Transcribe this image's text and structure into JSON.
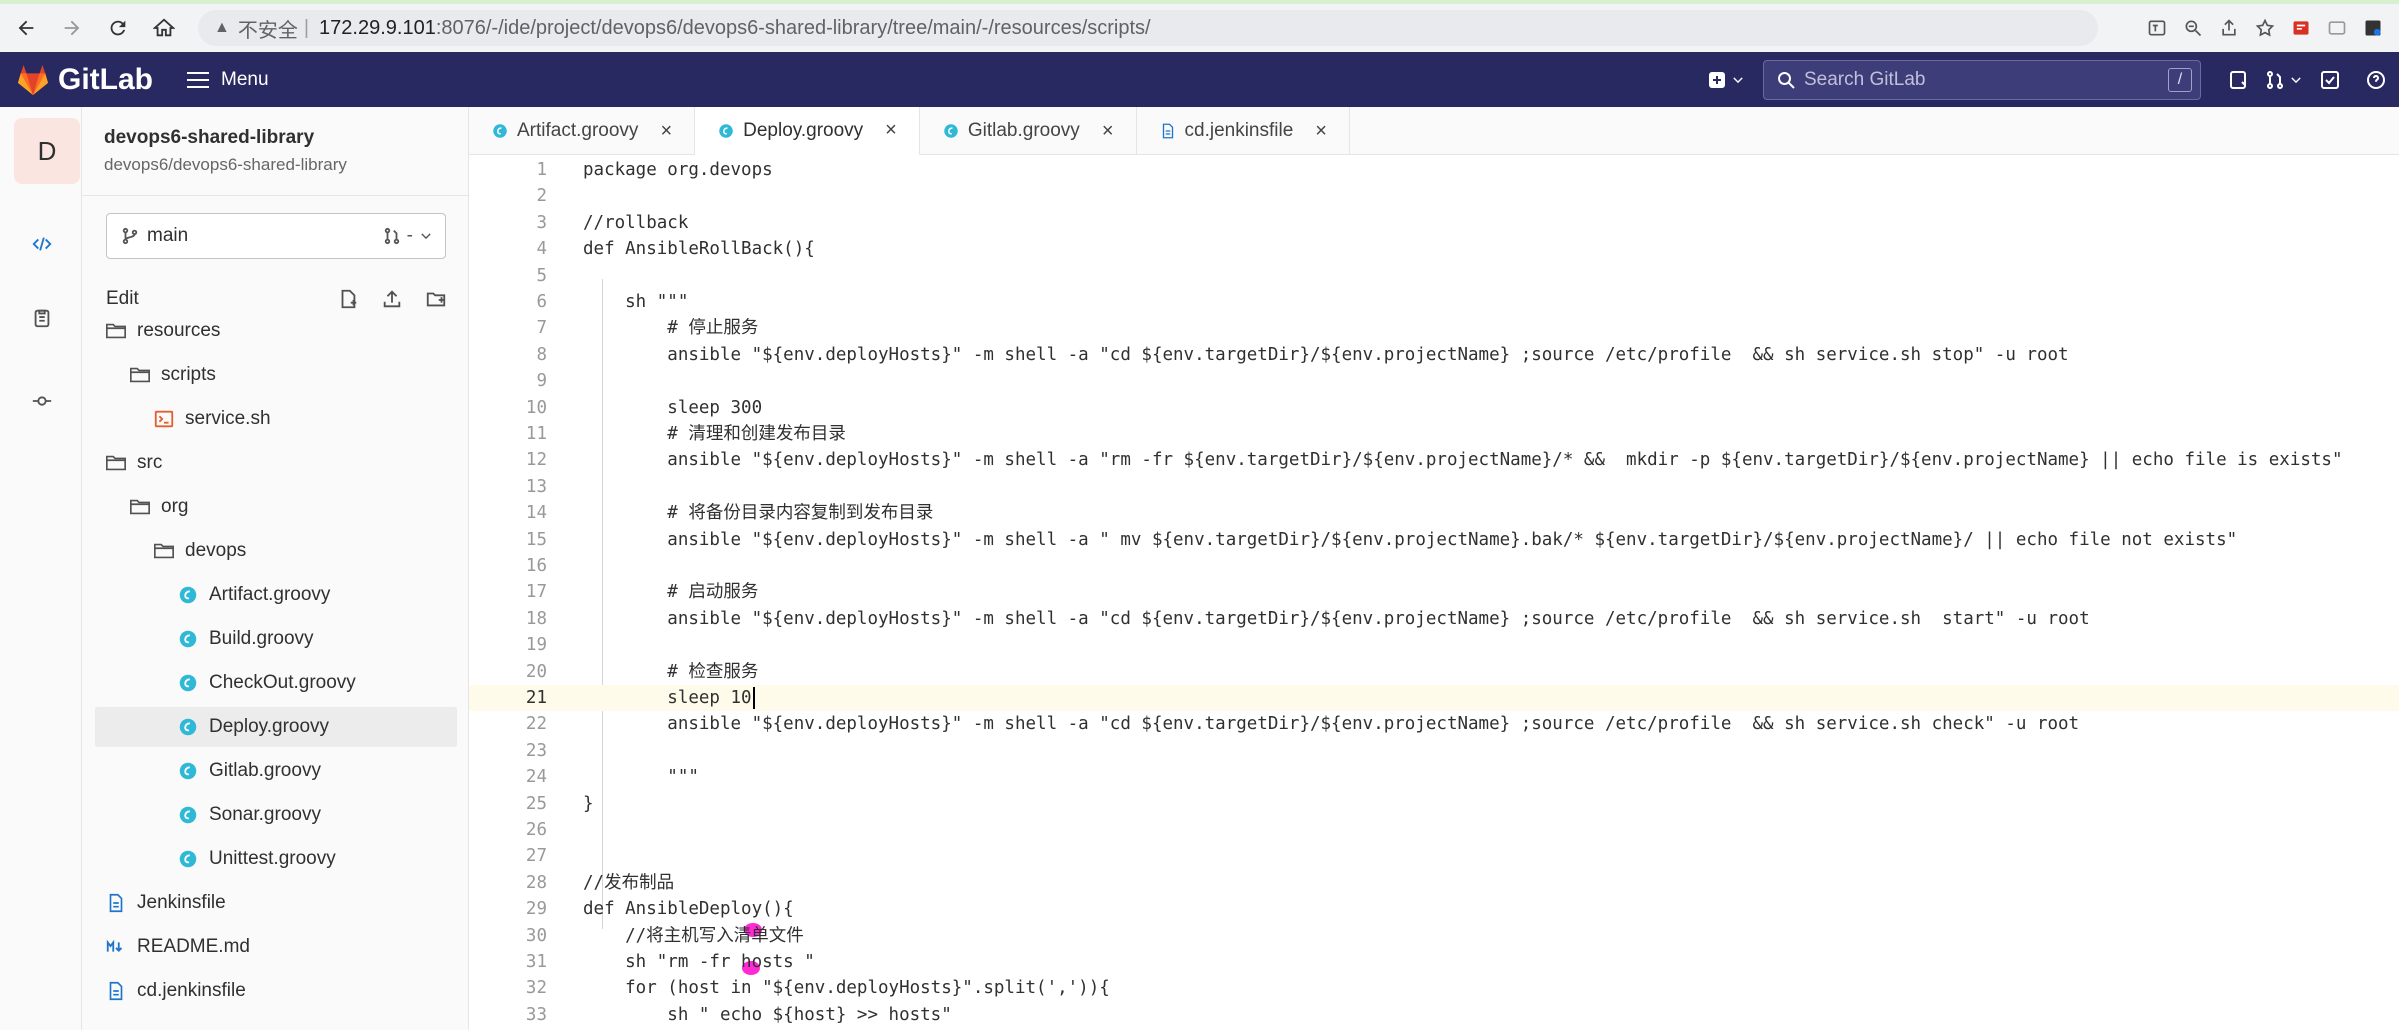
{
  "browser": {
    "insecure_label": "不安全",
    "url_host": "172.29.9.101",
    "url_path": ":8076/-/ide/project/devops6/devops6-shared-library/tree/main/-/resources/scripts/"
  },
  "header": {
    "logo_text": "GitLab",
    "menu_label": "Menu",
    "search_placeholder": "Search GitLab",
    "search_shortcut": "/"
  },
  "rail": {
    "avatar_letter": "D"
  },
  "project": {
    "name": "devops6-shared-library",
    "path": "devops6/devops6-shared-library",
    "branch": "main",
    "branch_suffix": "-",
    "edit_label": "Edit"
  },
  "tree": [
    {
      "label": "resources",
      "type": "folder",
      "depth": 0
    },
    {
      "label": "scripts",
      "type": "folder",
      "depth": 1
    },
    {
      "label": "service.sh",
      "type": "shell",
      "depth": 2
    },
    {
      "label": "src",
      "type": "folder",
      "depth": 0
    },
    {
      "label": "org",
      "type": "folder",
      "depth": 1
    },
    {
      "label": "devops",
      "type": "folder",
      "depth": 2
    },
    {
      "label": "Artifact.groovy",
      "type": "groovy",
      "depth": 3
    },
    {
      "label": "Build.groovy",
      "type": "groovy",
      "depth": 3
    },
    {
      "label": "CheckOut.groovy",
      "type": "groovy",
      "depth": 3
    },
    {
      "label": "Deploy.groovy",
      "type": "groovy",
      "depth": 3,
      "active": true
    },
    {
      "label": "Gitlab.groovy",
      "type": "groovy",
      "depth": 3
    },
    {
      "label": "Sonar.groovy",
      "type": "groovy",
      "depth": 3
    },
    {
      "label": "Unittest.groovy",
      "type": "groovy",
      "depth": 3
    },
    {
      "label": "Jenkinsfile",
      "type": "file",
      "depth": 0
    },
    {
      "label": "README.md",
      "type": "markdown",
      "depth": 0
    },
    {
      "label": "cd.jenkinsfile",
      "type": "file",
      "depth": 0
    }
  ],
  "tabs": [
    {
      "label": "Artifact.groovy",
      "type": "groovy"
    },
    {
      "label": "Deploy.groovy",
      "type": "groovy",
      "active": true
    },
    {
      "label": "Gitlab.groovy",
      "type": "groovy"
    },
    {
      "label": "cd.jenkinsfile",
      "type": "file"
    }
  ],
  "editor": {
    "current_line": 21,
    "lines": [
      "package org.devops",
      "",
      "//rollback",
      "def AnsibleRollBack(){",
      "",
      "    sh \"\"\"",
      "        # 停止服务",
      "        ansible \"${env.deployHosts}\" -m shell -a \"cd ${env.targetDir}/${env.projectName} ;source /etc/profile  && sh service.sh stop\" -u root",
      "",
      "        sleep 300",
      "        # 清理和创建发布目录",
      "        ansible \"${env.deployHosts}\" -m shell -a \"rm -fr ${env.targetDir}/${env.projectName}/* &&  mkdir -p ${env.targetDir}/${env.projectName} || echo file is exists\"",
      "",
      "        # 将备份目录内容复制到发布目录",
      "        ansible \"${env.deployHosts}\" -m shell -a \" mv ${env.targetDir}/${env.projectName}.bak/* ${env.targetDir}/${env.projectName}/ || echo file not exists\"",
      "",
      "        # 启动服务",
      "        ansible \"${env.deployHosts}\" -m shell -a \"cd ${env.targetDir}/${env.projectName} ;source /etc/profile  && sh service.sh  start\" -u root",
      "",
      "        # 检查服务",
      "        sleep 10",
      "        ansible \"${env.deployHosts}\" -m shell -a \"cd ${env.targetDir}/${env.projectName} ;source /etc/profile  && sh service.sh check\" -u root",
      "",
      "        \"\"\"",
      "}",
      "",
      "",
      "//发布制品",
      "def AnsibleDeploy(){",
      "    //将主机写入清单文件",
      "    sh \"rm -fr hosts \"",
      "    for (host in \"${env.deployHosts}\".split(',')){",
      "        sh \" echo ${host} >> hosts\"",
      "    }"
    ]
  },
  "colors": {
    "header_bg": "#292961",
    "groovy_icon": "#2fb9d6",
    "shell_icon": "#e2602f"
  }
}
